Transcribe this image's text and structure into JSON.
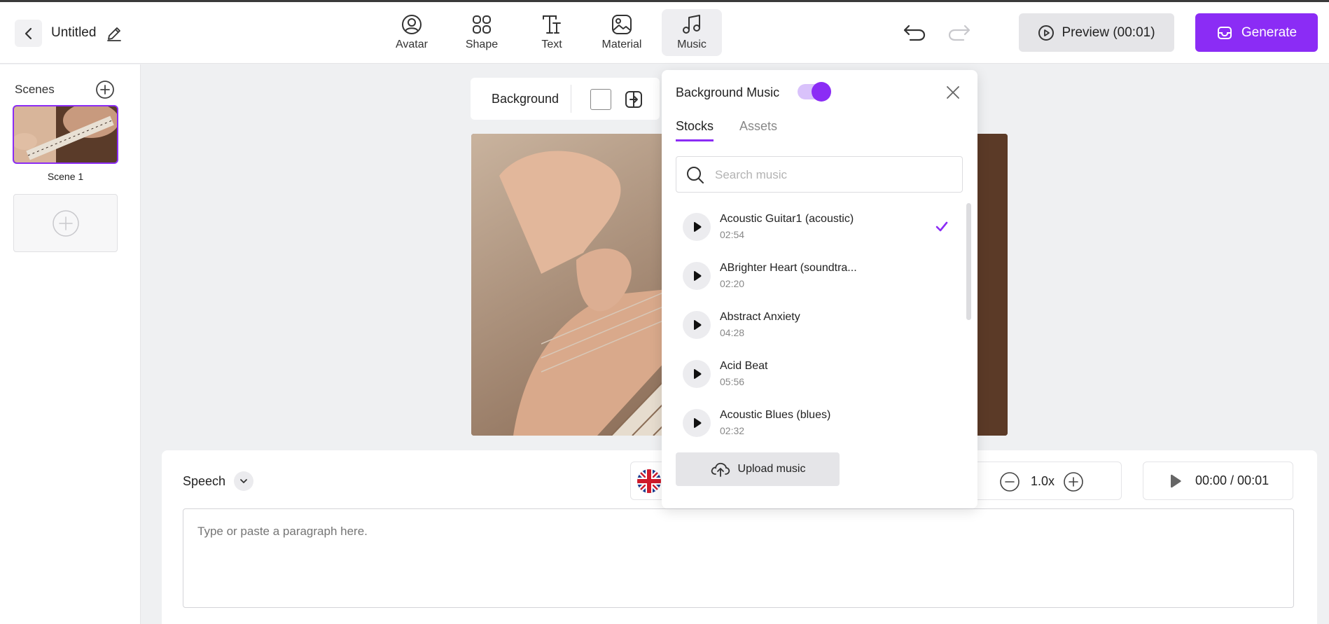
{
  "header": {
    "project_title": "Untitled",
    "tools": [
      {
        "label": "Avatar"
      },
      {
        "label": "Shape"
      },
      {
        "label": "Text"
      },
      {
        "label": "Material"
      },
      {
        "label": "Music"
      }
    ],
    "preview_label": "Preview (00:01)",
    "generate_label": "Generate"
  },
  "sidebar": {
    "title": "Scenes",
    "scenes": [
      {
        "name": "Scene 1"
      }
    ]
  },
  "background_toolbar": {
    "label": "Background"
  },
  "music_panel": {
    "title": "Background Music",
    "toggle_on": true,
    "tabs": [
      {
        "label": "Stocks"
      },
      {
        "label": "Assets"
      }
    ],
    "search_placeholder": "Search music",
    "tracks": [
      {
        "name": "Acoustic Guitar1 (acoustic)",
        "duration": "02:54",
        "selected": true
      },
      {
        "name": "ABrighter Heart (soundtra...",
        "duration": "02:20",
        "selected": false
      },
      {
        "name": "Abstract Anxiety",
        "duration": "04:28",
        "selected": false
      },
      {
        "name": "Acid Beat",
        "duration": "05:56",
        "selected": false
      },
      {
        "name": "Acoustic Blues (blues)",
        "duration": "02:32",
        "selected": false
      }
    ],
    "upload_label": "Upload music"
  },
  "speech": {
    "label": "Speech",
    "speed": "1.0x",
    "time": "00:00 / 00:01",
    "placeholder": "Type or paste a paragraph here."
  },
  "colors": {
    "accent": "#8b2cf5",
    "panel_bg": "#eff0f2"
  }
}
